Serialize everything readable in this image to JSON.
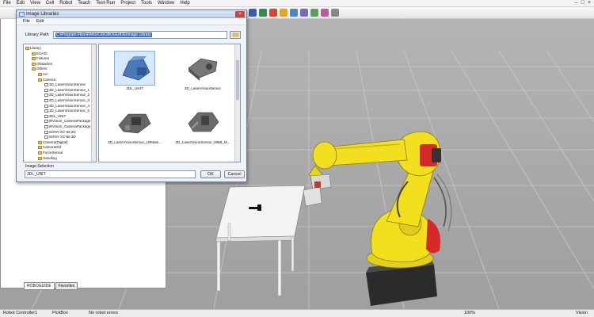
{
  "menu": [
    "File",
    "Edit",
    "View",
    "Cell",
    "Robot",
    "Teach",
    "Test-Run",
    "Project",
    "Tools",
    "Window",
    "Help"
  ],
  "window_controls": {
    "minimize": "–",
    "maximize": "□",
    "close": "×"
  },
  "side_tabs": [
    "ROBOGUIDE",
    "Favorites"
  ],
  "dialog": {
    "title": "Image Libraries",
    "close_glyph": "×",
    "menu": [
      "File",
      "Edit"
    ],
    "library_path_label": "Library Path",
    "library_path_value": "C:\\Program Files\\FANUC\\ROBOGUIDE\\Image Library",
    "tree": [
      {
        "label": "Library",
        "level": 0,
        "icon": "folder-icon"
      },
      {
        "label": "EOATs",
        "level": 1,
        "icon": "folder-icon"
      },
      {
        "label": "Fixtures",
        "level": 1,
        "icon": "folder-icon"
      },
      {
        "label": "Obstacles",
        "level": 1,
        "icon": "folder-icon"
      },
      {
        "label": "Others",
        "level": 1,
        "icon": "folder-icon"
      },
      {
        "label": "Arc",
        "level": 2,
        "icon": "folder-icon"
      },
      {
        "label": "Camera",
        "level": 2,
        "icon": "folder-icon"
      },
      {
        "label": "3D_LaserVisionSensor",
        "level": 3,
        "icon": "file-icon"
      },
      {
        "label": "3D_LaserVisionSensor_1",
        "level": 3,
        "icon": "file-icon"
      },
      {
        "label": "3D_LaserVisionSensor_2",
        "level": 3,
        "icon": "file-icon"
      },
      {
        "label": "3D_LaserVisionSensor_3",
        "level": 3,
        "icon": "file-icon"
      },
      {
        "label": "3D_LaserVisionSensor_4",
        "level": 3,
        "icon": "file-icon"
      },
      {
        "label": "3D_LaserVisionSensor_5",
        "level": 3,
        "icon": "file-icon"
      },
      {
        "label": "3DL_UNIT",
        "level": 3,
        "icon": "file-icon"
      },
      {
        "label": "iRVision_CameraPackage",
        "level": 3,
        "icon": "file-icon"
      },
      {
        "label": "iRVision_CameraPackage_2",
        "level": 3,
        "icon": "file-icon"
      },
      {
        "label": "SONY XC-56 2D",
        "level": 3,
        "icon": "file-icon"
      },
      {
        "label": "SONY XC-56 3D",
        "level": 3,
        "icon": "file-icon"
      },
      {
        "label": "Camera(Digital)",
        "level": 2,
        "icon": "folder-icon"
      },
      {
        "label": "CameraOld",
        "level": 2,
        "icon": "folder-icon"
      },
      {
        "label": "ForceSensor",
        "level": 2,
        "icon": "folder-icon"
      },
      {
        "label": "Handling",
        "level": 2,
        "icon": "folder-icon"
      }
    ],
    "thumbnails": [
      {
        "label": "3DL_UNIT",
        "selected": true
      },
      {
        "label": "3D_LaserVisionSensor",
        "selected": false
      },
      {
        "label": "3D_LaserVisionSensor_LRMate...",
        "selected": false
      },
      {
        "label": "3D_LaserVisionSensor_M6iB_M...",
        "selected": false
      }
    ],
    "image_selection_label": "Image Selection",
    "image_selection_value": "3DL_UNIT",
    "ok_label": "OK",
    "cancel_label": "Cancel"
  },
  "status": {
    "controller": "Robot Controller1",
    "program": "PickBox",
    "robot_status": "No robot errors",
    "zoom": "100%",
    "right": "Vision"
  },
  "colors": {
    "robot_yellow": "#f2e01e",
    "robot_red": "#d42a2a",
    "floor_grey": "#a9a9a9",
    "selection_blue": "#3a6fd0"
  }
}
